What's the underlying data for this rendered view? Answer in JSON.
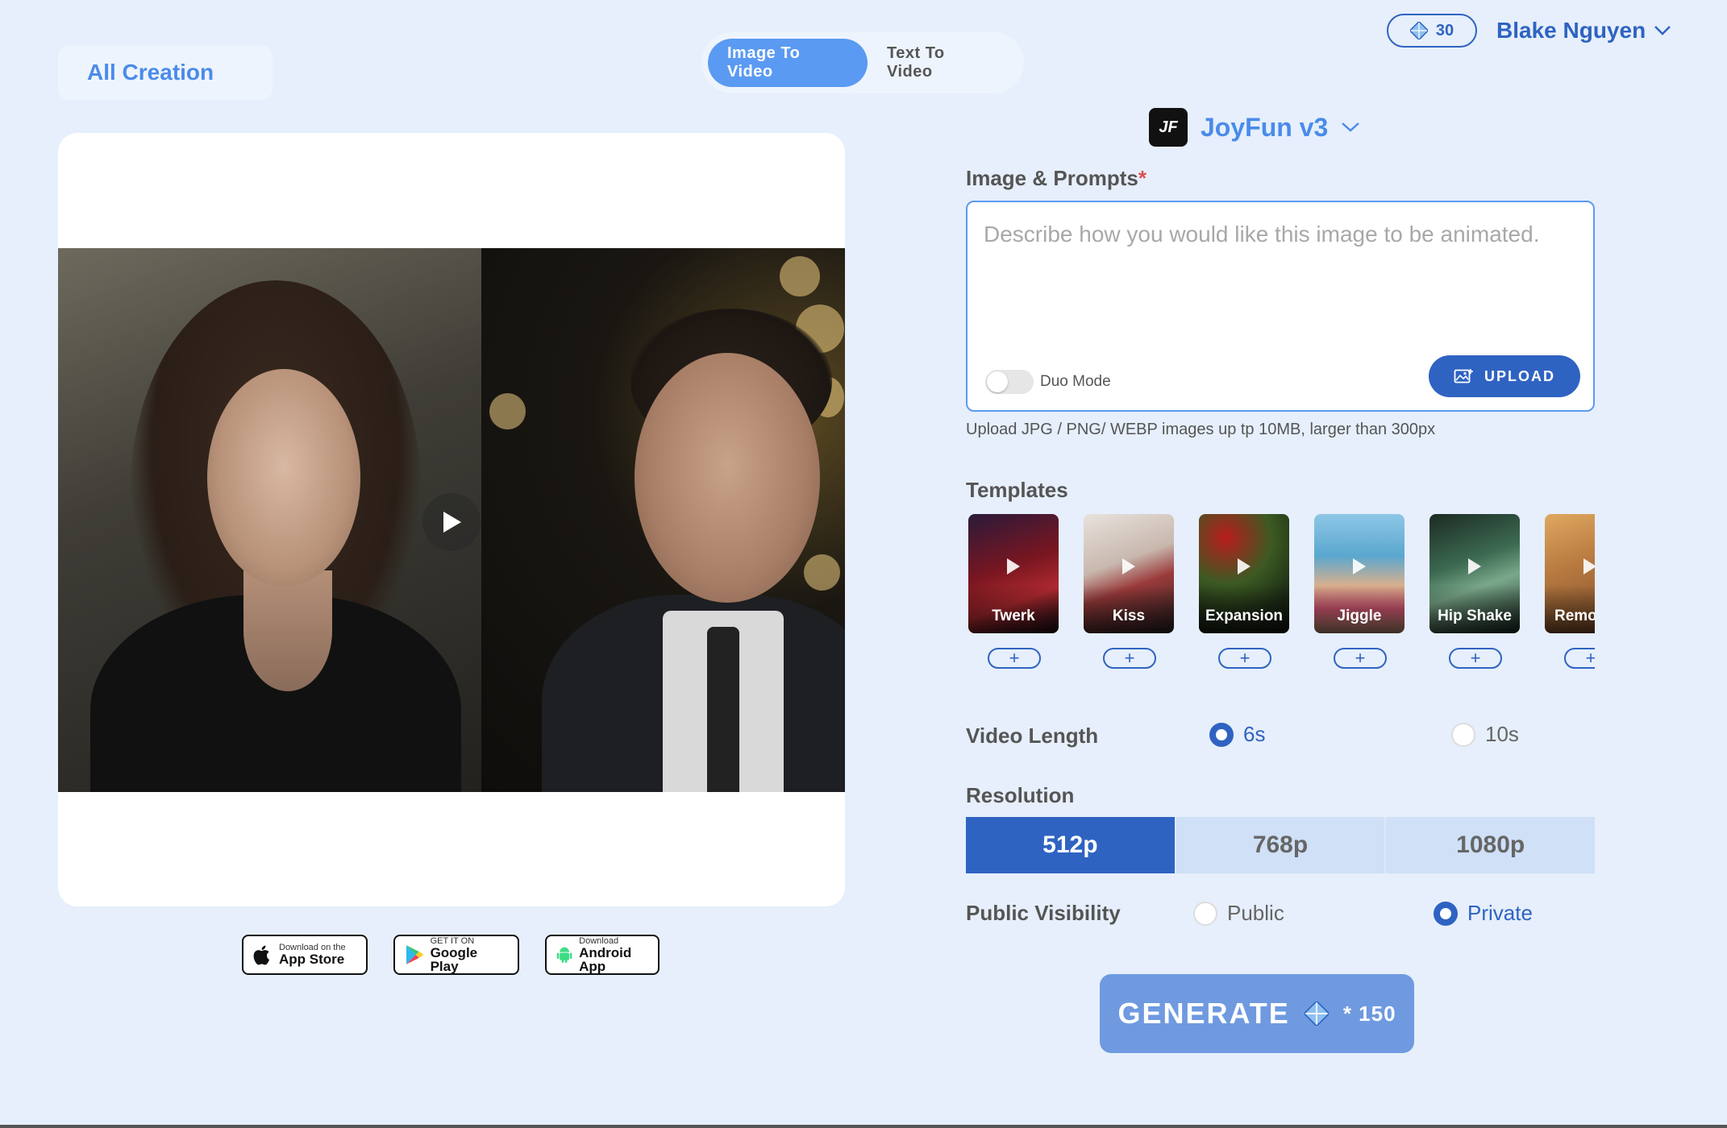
{
  "top": {
    "all_creation": "All Creation",
    "mode_tabs": [
      "Image To Video",
      "Text To Video"
    ],
    "credits": "30",
    "user_name": "Blake Nguyen"
  },
  "model": {
    "logo_text": "JF",
    "name": "JoyFun v3"
  },
  "prompt": {
    "label": "Image & Prompts",
    "required_mark": "*",
    "placeholder": "Describe how you would like this image to be animated.",
    "value": "",
    "duo_mode_label": "Duo Mode",
    "duo_mode_on": false,
    "upload_label": "UPLOAD",
    "hint": "Upload JPG / PNG/ WEBP images up tp 10MB, larger than 300px"
  },
  "templates": {
    "label": "Templates",
    "items": [
      {
        "name": "Twerk"
      },
      {
        "name": "Kiss"
      },
      {
        "name": "Expansion"
      },
      {
        "name": "Jiggle"
      },
      {
        "name": "Hip Shake"
      },
      {
        "name": "Remo"
      }
    ]
  },
  "video_length": {
    "label": "Video Length",
    "options": [
      "6s",
      "10s"
    ],
    "selected": "6s"
  },
  "resolution": {
    "label": "Resolution",
    "options": [
      "512p",
      "768p",
      "1080p"
    ],
    "selected": "512p"
  },
  "visibility": {
    "label": "Public Visibility",
    "options": [
      "Public",
      "Private"
    ],
    "selected": "Private"
  },
  "generate": {
    "label": "GENERATE",
    "cost": "* 150"
  },
  "store_badges": [
    {
      "small": "Download on the",
      "big": "App Store",
      "icon": "apple-icon"
    },
    {
      "small": "GET IT ON",
      "big": "Google Play",
      "icon": "google-play-icon"
    },
    {
      "small": "Download",
      "big": "Android App",
      "icon": "android-icon"
    }
  ],
  "colors": {
    "background": "#e6effb",
    "accent": "#2f63c2",
    "accent_light": "#5b9af2",
    "generate": "#6f9ae0"
  }
}
